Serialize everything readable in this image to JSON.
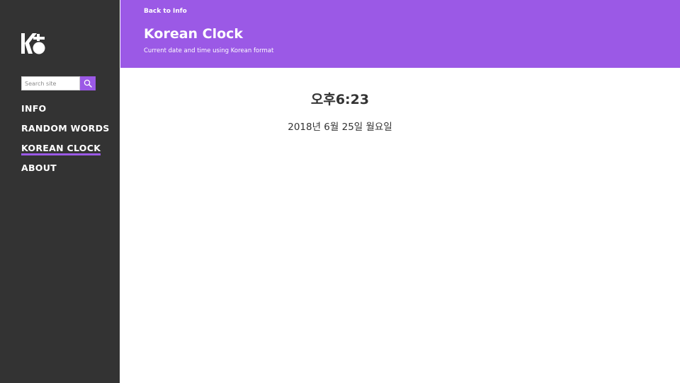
{
  "sidebar": {
    "logo_name": "site-logo",
    "search": {
      "placeholder": "Search site",
      "value": ""
    },
    "nav": [
      {
        "label": "INFO",
        "active": false
      },
      {
        "label": "RANDOM WORDS",
        "active": false
      },
      {
        "label": "KOREAN CLOCK",
        "active": true
      },
      {
        "label": "ABOUT",
        "active": false
      }
    ]
  },
  "header": {
    "back_link": "Back to Info",
    "title": "Korean Clock",
    "subtitle": "Current date and time using Korean format"
  },
  "clock": {
    "time": "오후6:23",
    "date": "2018년 6월 25일 월요일"
  },
  "colors": {
    "accent": "#9b59e6",
    "sidebar_bg": "#333333",
    "text": "#333333"
  }
}
